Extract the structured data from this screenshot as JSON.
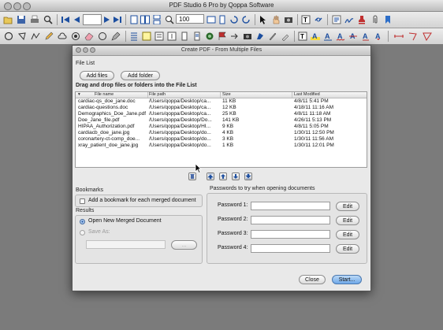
{
  "app": {
    "title": "PDF Studio 6 Pro by Qoppa Software",
    "zoom_value": "100",
    "toolbar_row1_icons": [
      "open-icon",
      "save-icon",
      "print-icon",
      "first-page-icon",
      "prev-page-icon",
      "next-page-icon",
      "last-page-icon",
      "single-page-icon",
      "two-page-icon",
      "zoom-select",
      "fit-width-icon",
      "select-tool-icon",
      "text-select-icon",
      "zoom-tool-icon",
      "hand-tool-icon",
      "sign-icon",
      "stamp-icon",
      "link-icon",
      "form-icon",
      "attach-icon",
      "find-icon",
      "bookmark-icon"
    ],
    "toolbar_row2_icons": [
      "circle-icon",
      "polygon-icon",
      "pencil-icon",
      "eraser-icon",
      "cloud-icon",
      "strikeout-icon",
      "note-icon",
      "highlight-icon",
      "text-box-icon",
      "callout-icon",
      "line-icon",
      "arrow-icon",
      "measure-icon"
    ]
  },
  "dialog": {
    "title": "Create PDF - From Multiple Files",
    "file_list_title": "File List",
    "add_files_label": "Add files",
    "add_folder_label": "Add folder",
    "drag_instruction": "Drag and drop files or folders into the File List",
    "columns": [
      "File name",
      "File path",
      "Size",
      "Last Modified"
    ],
    "files": [
      {
        "name": "cardiac-qs_doe_jane.doc",
        "path": "/Users/qoppa/Desktop/ca...",
        "size": "11 KB",
        "modified": "4/8/11 5:41 PM"
      },
      {
        "name": "cardiac-questions.doc",
        "path": "/Users/qoppa/Desktop/ca...",
        "size": "12 KB",
        "modified": "4/18/11 11:16 AM"
      },
      {
        "name": "Demographics_Doe_Jane.pdf",
        "path": "/Users/qoppa/Desktop/ca...",
        "size": "25 KB",
        "modified": "4/8/11 11:18 AM"
      },
      {
        "name": "Doe_Jane_file.pdf",
        "path": "/Users/qoppa/Desktop/Do...",
        "size": "141 KB",
        "modified": "4/26/11 5:13 PM"
      },
      {
        "name": "HIPAA_Authorization.pdf",
        "path": "/Users/qoppa/Desktop/HI...",
        "size": "9 KB",
        "modified": "4/8/11 5:05 PM"
      },
      {
        "name": "cardiacb_doe_jane.jpg",
        "path": "/Users/qoppa/Desktop/do...",
        "size": "4 KB",
        "modified": "1/30/11 12:50 PM"
      },
      {
        "name": "coronartery-ct-comp_doe...",
        "path": "/Users/qoppa/Desktop/do...",
        "size": "3 KB",
        "modified": "1/30/11 11:56 AM"
      },
      {
        "name": "xray_patient_doe_jane.jpg",
        "path": "/Users/qoppa/Desktop/do...",
        "size": "1 KB",
        "modified": "1/30/11 12:01 PM"
      }
    ],
    "bookmarks_title": "Bookmarks",
    "bookmark_option": "Add a bookmark for each merged document",
    "results_title": "Results",
    "open_new_label": "Open New Merged Document",
    "save_as_label": "Save As:",
    "browse_label": "...",
    "passwords_title": "Passwords to try when opening documents",
    "passwords": [
      {
        "label": "Password 1:",
        "edit": "Edit"
      },
      {
        "label": "Password 2:",
        "edit": "Edit"
      },
      {
        "label": "Password 3:",
        "edit": "Edit"
      },
      {
        "label": "Password 4:",
        "edit": "Edit"
      }
    ],
    "close_label": "Close",
    "start_label": "Start..."
  }
}
